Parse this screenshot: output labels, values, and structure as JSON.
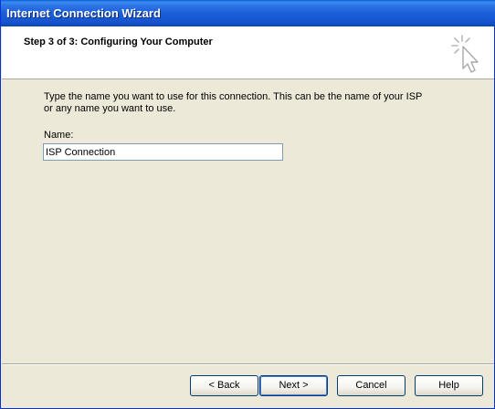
{
  "window": {
    "title": "Internet Connection Wizard"
  },
  "header": {
    "step_title": "Step 3 of 3: Configuring Your Computer",
    "icon": "cursor-sparkle-icon"
  },
  "content": {
    "instruction_line1": "Type the name you want to use for this connection. This can be the name of your ISP",
    "instruction_line2": "or any name you want to use.",
    "name_label": "Name:",
    "name_value": "ISP Connection"
  },
  "buttons": {
    "back": "< Back",
    "next": "Next >",
    "cancel": "Cancel",
    "help": "Help"
  }
}
